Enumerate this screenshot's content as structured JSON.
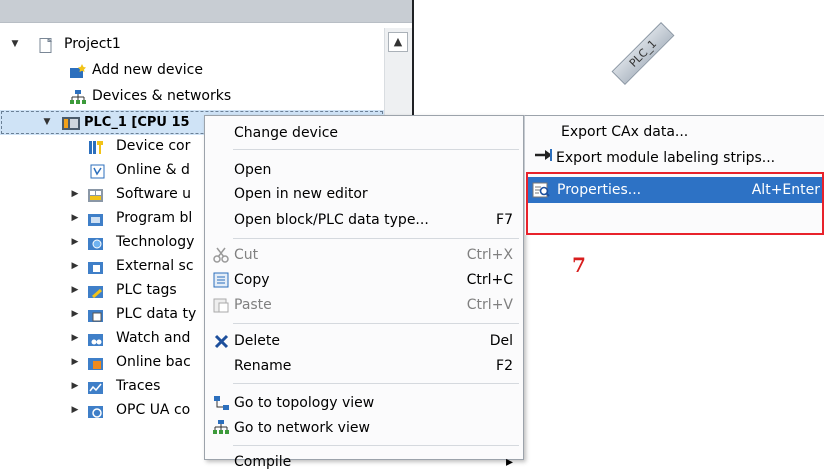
{
  "tree": {
    "items": [
      {
        "label": "Project1",
        "expanded": true,
        "icon": "project-icon"
      },
      {
        "label": "Add new device",
        "icon": "add-device-icon"
      },
      {
        "label": "Devices & networks",
        "icon": "network-icon"
      },
      {
        "label": "PLC_1 [CPU 15",
        "expanded": true,
        "selected": true,
        "icon": "plc-icon"
      },
      {
        "label": "Device cor",
        "icon": "device-config-icon"
      },
      {
        "label": "Online & d",
        "icon": "online-diag-icon"
      },
      {
        "label": "Software u",
        "icon": "software-units-icon"
      },
      {
        "label": "Program bl",
        "icon": "program-blocks-icon"
      },
      {
        "label": "Technology",
        "icon": "technology-icon"
      },
      {
        "label": "External sc",
        "icon": "external-source-icon"
      },
      {
        "label": "PLC tags",
        "icon": "plc-tags-icon"
      },
      {
        "label": "PLC data ty",
        "icon": "plc-datatype-icon"
      },
      {
        "label": "Watch and",
        "icon": "watch-table-icon"
      },
      {
        "label": "Online bac",
        "icon": "online-backup-icon"
      },
      {
        "label": "Traces",
        "icon": "traces-icon"
      },
      {
        "label": "OPC UA co",
        "icon": "opcua-icon"
      }
    ]
  },
  "canvas": {
    "device_label": "PLC_1"
  },
  "context_menu": {
    "items": [
      {
        "label": "Change device",
        "shortcut": ""
      },
      {
        "label": "Open",
        "shortcut": ""
      },
      {
        "label": "Open in new editor",
        "shortcut": ""
      },
      {
        "label": "Open block/PLC data type...",
        "shortcut": "F7"
      },
      {
        "label": "Cut",
        "shortcut": "Ctrl+X",
        "disabled": true,
        "icon": "cut-icon"
      },
      {
        "label": "Copy",
        "shortcut": "Ctrl+C",
        "icon": "copy-icon"
      },
      {
        "label": "Paste",
        "shortcut": "Ctrl+V",
        "disabled": true,
        "icon": "paste-icon"
      },
      {
        "label": "Delete",
        "shortcut": "Del",
        "icon": "delete-icon"
      },
      {
        "label": "Rename",
        "shortcut": "F2"
      },
      {
        "label": "Go to topology view",
        "shortcut": "",
        "icon": "topology-icon"
      },
      {
        "label": "Go to network view",
        "shortcut": "",
        "icon": "network-view-icon"
      },
      {
        "label": "Compile",
        "shortcut": "",
        "partial": true
      }
    ]
  },
  "submenu": {
    "items": [
      {
        "label": "Export CAx data...",
        "shortcut": ""
      },
      {
        "label": "Export module labeling strips...",
        "shortcut": "",
        "icon": "export-arrow-icon"
      },
      {
        "label": "Properties...",
        "shortcut": "Alt+Enter",
        "highlighted": true,
        "icon": "properties-icon"
      }
    ]
  },
  "annotation": {
    "step_number": "7",
    "box_color": "#e8222b"
  },
  "colors": {
    "selection": "#2d72c5",
    "tree_selected": "#cfe3f6",
    "step_red": "#d81e1e"
  }
}
